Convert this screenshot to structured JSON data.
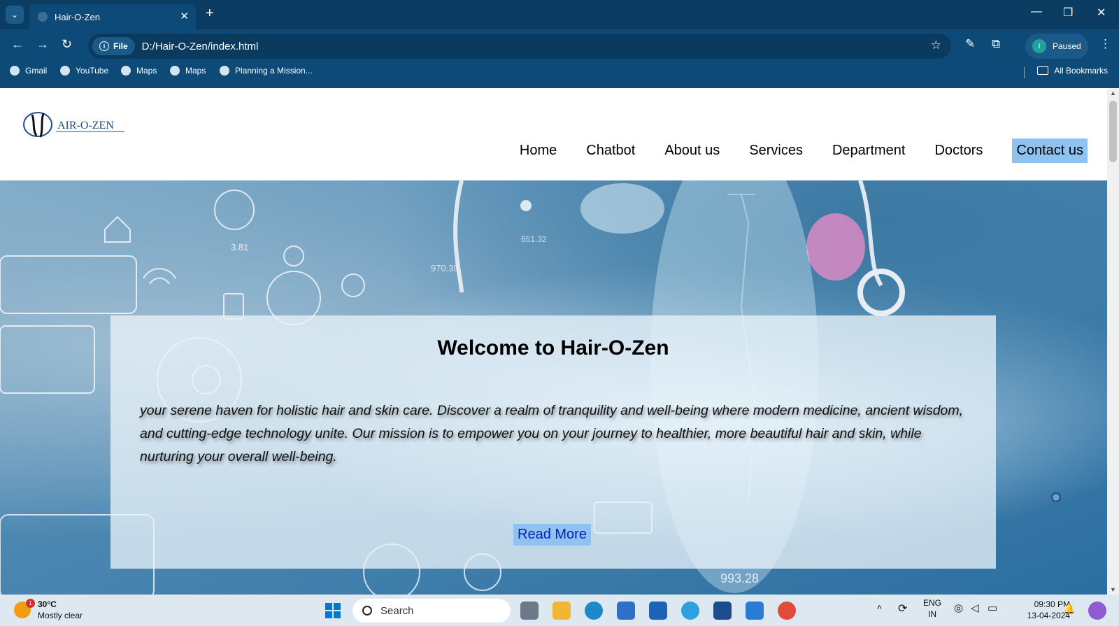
{
  "browser": {
    "tab_title": "Hair-O-Zen",
    "tab_close": "✕",
    "new_tab": "+",
    "url_chip": "File",
    "url": "D:/Hair-O-Zen/index.html",
    "profile_label": "Paused",
    "profile_initial": "I",
    "bookmarks": [
      "Gmail",
      "YouTube",
      "Maps",
      "Maps",
      "Planning a Mission..."
    ],
    "all_bookmarks": "All Bookmarks"
  },
  "site": {
    "logo_text": "AIR-O-ZEN",
    "nav": [
      "Home",
      "Chatbot",
      "About us",
      "Services",
      "Department",
      "Doctors",
      "Contact us"
    ],
    "hero_title": "Welcome to Hair-O-Zen",
    "hero_text": "your serene haven for holistic hair and skin care. Discover a realm of tranquility and well-being where modern medicine, ancient wisdom, and cutting-edge technology unite. Our mission is to empower you on your journey to healthier, more beautiful hair and skin, while nurturing your overall well-being.",
    "read_more": "Read More",
    "deco_numbers": [
      "3.81",
      "970.30",
      "651.32",
      "993.28"
    ]
  },
  "taskbar": {
    "temperature": "30°C",
    "weather": "Mostly clear",
    "weather_badge": "1",
    "search_placeholder": "Search",
    "lang": "ENG",
    "region": "IN",
    "time": "09:30 PM",
    "date": "13-04-2024"
  },
  "colors": {
    "chrome": "#0d4a78",
    "accent": "#8ec3f1",
    "link": "#0a1ec0"
  }
}
